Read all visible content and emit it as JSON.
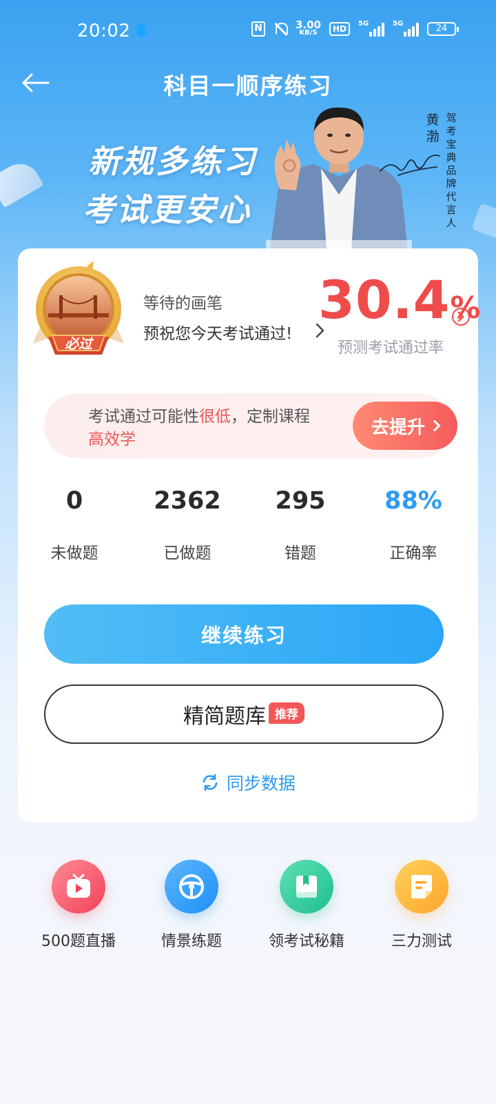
{
  "status_bar": {
    "time": "20:02",
    "net_speed_value": "3.00",
    "net_speed_unit": "KB/S",
    "hd_label": "HD",
    "signal1_label": "5G",
    "signal2_label": "5G",
    "battery": "24"
  },
  "header": {
    "title": "科目一顺序练习",
    "back_icon": "arrow-left-icon"
  },
  "banner": {
    "slogan_line1": "新规多练习",
    "slogan_line2": "考试更安心",
    "endorser_name": "黄渤",
    "endorser_role": "驾考宝典品牌代言人"
  },
  "profile": {
    "badge_text": "必过",
    "nickname": "等待的画笔",
    "wish": "预祝您今天考试通过!",
    "pass_rate_value": "30.4",
    "pass_rate_unit": "%",
    "pass_rate_label": "预测考试通过率"
  },
  "promo": {
    "text_before": "考试通过可能性",
    "text_highlight": "很低",
    "text_after": "，定制课程",
    "text_line2": "高效学",
    "button_label": "去提升"
  },
  "stats": [
    {
      "value": "0",
      "label": "未做题"
    },
    {
      "value": "2362",
      "label": "已做题"
    },
    {
      "value": "295",
      "label": "错题"
    },
    {
      "value": "88%",
      "label": "正确率"
    }
  ],
  "actions": {
    "continue_label": "继续练习",
    "bank_label": "精简题库",
    "bank_tag": "推荐",
    "sync_label": "同步数据"
  },
  "tools": [
    {
      "label": "500题直播",
      "icon": "tv-play-icon"
    },
    {
      "label": "情景练题",
      "icon": "steering-wheel-icon"
    },
    {
      "label": "领考试秘籍",
      "icon": "book-icon"
    },
    {
      "label": "三力测试",
      "icon": "document-icon"
    }
  ],
  "colors": {
    "accent_blue": "#2d9cf0",
    "accent_red": "#ef4b4b"
  }
}
